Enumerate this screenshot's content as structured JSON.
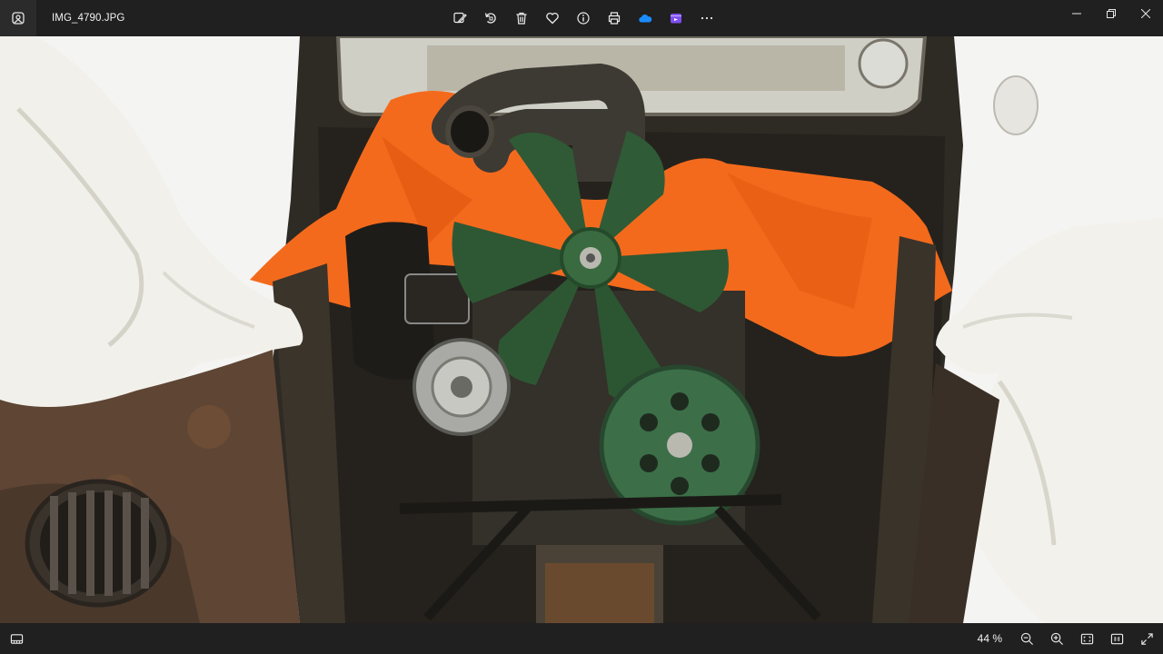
{
  "window": {
    "file_name": "IMG_4790.JPG"
  },
  "toolbar": {
    "buttons": [
      "edit-image-icon",
      "rotate-icon",
      "delete-icon",
      "favorite-icon",
      "file-info-icon",
      "print-icon",
      "onedrive-icon",
      "clipchamp-icon",
      "more-icon"
    ]
  },
  "photo": {
    "subject": "engine-bay-photo"
  },
  "statusbar": {
    "zoom_level": "44 %"
  },
  "colors": {
    "titlebar": "#202020",
    "statusbar": "#202020",
    "onedrive": "#1a8cff",
    "clipchamp": "#7f4ff2"
  }
}
